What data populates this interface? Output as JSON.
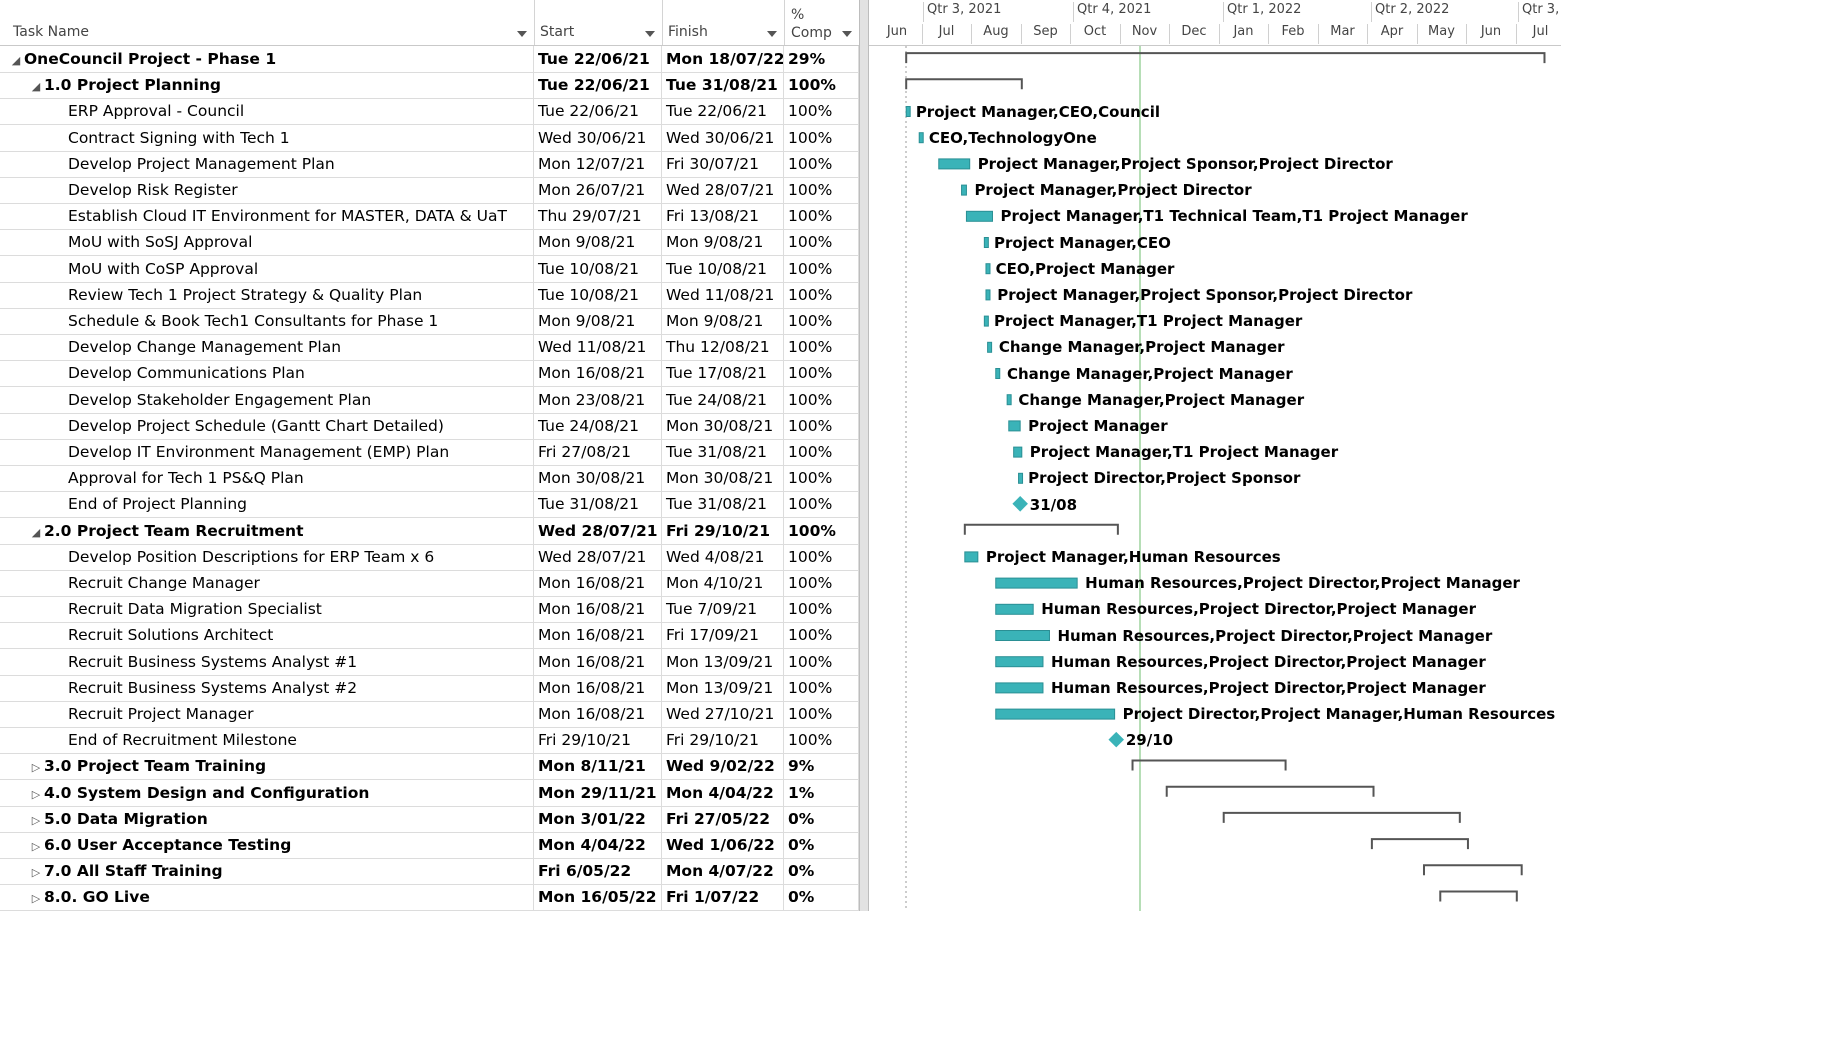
{
  "columns": {
    "task_name": "Task Name",
    "start": "Start",
    "finish": "Finish",
    "pct_top": "%",
    "pct_bottom": "Comp"
  },
  "tasks": [
    {
      "name": "OneCouncil Project - Phase 1",
      "start": "Tue 22/06/21",
      "finish": "Mon 18/07/22",
      "pct": "29%",
      "level": 0,
      "summary": true,
      "toggle": "◢"
    },
    {
      "name": "1.0 Project Planning",
      "start": "Tue 22/06/21",
      "finish": "Tue 31/08/21",
      "pct": "100%",
      "level": 1,
      "summary": true,
      "toggle": "◢"
    },
    {
      "name": "ERP Approval - Council",
      "start": "Tue 22/06/21",
      "finish": "Tue 22/06/21",
      "pct": "100%",
      "level": 2,
      "summary": false,
      "toggle": ""
    },
    {
      "name": "Contract Signing with Tech 1",
      "start": "Wed 30/06/21",
      "finish": "Wed 30/06/21",
      "pct": "100%",
      "level": 2,
      "summary": false,
      "toggle": ""
    },
    {
      "name": "Develop Project Management Plan",
      "start": "Mon 12/07/21",
      "finish": "Fri 30/07/21",
      "pct": "100%",
      "level": 2,
      "summary": false,
      "toggle": ""
    },
    {
      "name": "Develop Risk Register",
      "start": "Mon 26/07/21",
      "finish": "Wed 28/07/21",
      "pct": "100%",
      "level": 2,
      "summary": false,
      "toggle": ""
    },
    {
      "name": "Establish Cloud IT Environment for MASTER, DATA & UaT",
      "start": "Thu 29/07/21",
      "finish": "Fri 13/08/21",
      "pct": "100%",
      "level": 2,
      "summary": false,
      "toggle": ""
    },
    {
      "name": "MoU with SoSJ Approval",
      "start": "Mon 9/08/21",
      "finish": "Mon 9/08/21",
      "pct": "100%",
      "level": 2,
      "summary": false,
      "toggle": ""
    },
    {
      "name": "MoU with CoSP Approval",
      "start": "Tue 10/08/21",
      "finish": "Tue 10/08/21",
      "pct": "100%",
      "level": 2,
      "summary": false,
      "toggle": ""
    },
    {
      "name": "Review Tech 1 Project Strategy & Quality Plan",
      "start": "Tue 10/08/21",
      "finish": "Wed 11/08/21",
      "pct": "100%",
      "level": 2,
      "summary": false,
      "toggle": ""
    },
    {
      "name": "Schedule & Book Tech1 Consultants for Phase 1",
      "start": "Mon 9/08/21",
      "finish": "Mon 9/08/21",
      "pct": "100%",
      "level": 2,
      "summary": false,
      "toggle": ""
    },
    {
      "name": "Develop Change Management Plan",
      "start": "Wed 11/08/21",
      "finish": "Thu 12/08/21",
      "pct": "100%",
      "level": 2,
      "summary": false,
      "toggle": ""
    },
    {
      "name": "Develop Communications Plan",
      "start": "Mon 16/08/21",
      "finish": "Tue 17/08/21",
      "pct": "100%",
      "level": 2,
      "summary": false,
      "toggle": ""
    },
    {
      "name": "Develop Stakeholder Engagement Plan",
      "start": "Mon 23/08/21",
      "finish": "Tue 24/08/21",
      "pct": "100%",
      "level": 2,
      "summary": false,
      "toggle": ""
    },
    {
      "name": "Develop Project Schedule (Gantt Chart Detailed)",
      "start": "Tue 24/08/21",
      "finish": "Mon 30/08/21",
      "pct": "100%",
      "level": 2,
      "summary": false,
      "toggle": ""
    },
    {
      "name": "Develop IT Environment Management (EMP) Plan",
      "start": "Fri 27/08/21",
      "finish": "Tue 31/08/21",
      "pct": "100%",
      "level": 2,
      "summary": false,
      "toggle": ""
    },
    {
      "name": "Approval for Tech 1 PS&Q Plan",
      "start": "Mon 30/08/21",
      "finish": "Mon 30/08/21",
      "pct": "100%",
      "level": 2,
      "summary": false,
      "toggle": ""
    },
    {
      "name": "End of Project Planning",
      "start": "Tue 31/08/21",
      "finish": "Tue 31/08/21",
      "pct": "100%",
      "level": 2,
      "summary": false,
      "toggle": ""
    },
    {
      "name": "2.0 Project Team Recruitment",
      "start": "Wed 28/07/21",
      "finish": "Fri 29/10/21",
      "pct": "100%",
      "level": 1,
      "summary": true,
      "toggle": "◢"
    },
    {
      "name": "Develop Position Descriptions for ERP Team x 6",
      "start": "Wed 28/07/21",
      "finish": "Wed 4/08/21",
      "pct": "100%",
      "level": 2,
      "summary": false,
      "toggle": ""
    },
    {
      "name": "Recruit Change Manager",
      "start": "Mon 16/08/21",
      "finish": "Mon 4/10/21",
      "pct": "100%",
      "level": 2,
      "summary": false,
      "toggle": ""
    },
    {
      "name": "Recruit Data Migration Specialist",
      "start": "Mon 16/08/21",
      "finish": "Tue 7/09/21",
      "pct": "100%",
      "level": 2,
      "summary": false,
      "toggle": ""
    },
    {
      "name": "Recruit Solutions Architect",
      "start": "Mon 16/08/21",
      "finish": "Fri 17/09/21",
      "pct": "100%",
      "level": 2,
      "summary": false,
      "toggle": ""
    },
    {
      "name": "Recruit Business Systems Analyst #1",
      "start": "Mon 16/08/21",
      "finish": "Mon 13/09/21",
      "pct": "100%",
      "level": 2,
      "summary": false,
      "toggle": ""
    },
    {
      "name": "Recruit Business Systems Analyst #2",
      "start": "Mon 16/08/21",
      "finish": "Mon 13/09/21",
      "pct": "100%",
      "level": 2,
      "summary": false,
      "toggle": ""
    },
    {
      "name": "Recruit Project Manager",
      "start": "Mon 16/08/21",
      "finish": "Wed 27/10/21",
      "pct": "100%",
      "level": 2,
      "summary": false,
      "toggle": ""
    },
    {
      "name": "End of Recruitment Milestone",
      "start": "Fri 29/10/21",
      "finish": "Fri 29/10/21",
      "pct": "100%",
      "level": 2,
      "summary": false,
      "toggle": ""
    },
    {
      "name": "3.0 Project Team Training",
      "start": "Mon 8/11/21",
      "finish": "Wed 9/02/22",
      "pct": "9%",
      "level": 1,
      "summary": true,
      "toggle": "▷"
    },
    {
      "name": "4.0 System Design and Configuration",
      "start": "Mon 29/11/21",
      "finish": "Mon 4/04/22",
      "pct": "1%",
      "level": 1,
      "summary": true,
      "toggle": "▷"
    },
    {
      "name": "5.0 Data Migration",
      "start": "Mon 3/01/22",
      "finish": "Fri 27/05/22",
      "pct": "0%",
      "level": 1,
      "summary": true,
      "toggle": "▷"
    },
    {
      "name": "6.0 User Acceptance Testing",
      "start": "Mon 4/04/22",
      "finish": "Wed 1/06/22",
      "pct": "0%",
      "level": 1,
      "summary": true,
      "toggle": "▷"
    },
    {
      "name": "7.0 All Staff Training",
      "start": "Fri 6/05/22",
      "finish": "Mon 4/07/22",
      "pct": "0%",
      "level": 1,
      "summary": true,
      "toggle": "▷"
    },
    {
      "name": "8.0. GO Live",
      "start": "Mon 16/05/22",
      "finish": "Fri 1/07/22",
      "pct": "0%",
      "level": 1,
      "summary": true,
      "toggle": "▷"
    }
  ],
  "gantt": {
    "quarters": [
      "Qtr 3, 2021",
      "Qtr 4, 2021",
      "Qtr 1, 2022",
      "Qtr 2, 2022",
      "Qtr 3,"
    ],
    "months": [
      "Jun",
      "Jul",
      "Aug",
      "Sep",
      "Oct",
      "Nov",
      "Dec",
      "Jan",
      "Feb",
      "Mar",
      "Apr",
      "May",
      "Jun",
      "Jul"
    ],
    "resources": [
      "",
      "",
      "Project Manager,CEO,Council",
      "CEO,TechnologyOne",
      "Project Manager,Project Sponsor,Project Director",
      "Project Manager,Project Director",
      "Project Manager,T1 Technical Team,T1 Project Manager",
      "Project Manager,CEO",
      "CEO,Project Manager",
      "Project Manager,Project Sponsor,Project Director",
      "Project Manager,T1 Project Manager",
      "Change Manager,Project Manager",
      "Change Manager,Project Manager",
      "Change Manager,Project Manager",
      "Project Manager",
      "Project Manager,T1 Project Manager",
      "Project Director,Project Sponsor",
      "31/08",
      "",
      "Project Manager,Human Resources",
      "Human Resources,Project Director,Project Manager",
      "Human Resources,Project Director,Project Manager",
      "Human Resources,Project Director,Project Manager",
      "Human Resources,Project Director,Project Manager",
      "Human Resources,Project Director,Project Manager",
      "Project Director,Project Manager,Human Resources",
      "29/10",
      "",
      "",
      "",
      "",
      "",
      ""
    ],
    "bar_color": "#3ab3b8",
    "today_line_color": "#9ed39e"
  }
}
